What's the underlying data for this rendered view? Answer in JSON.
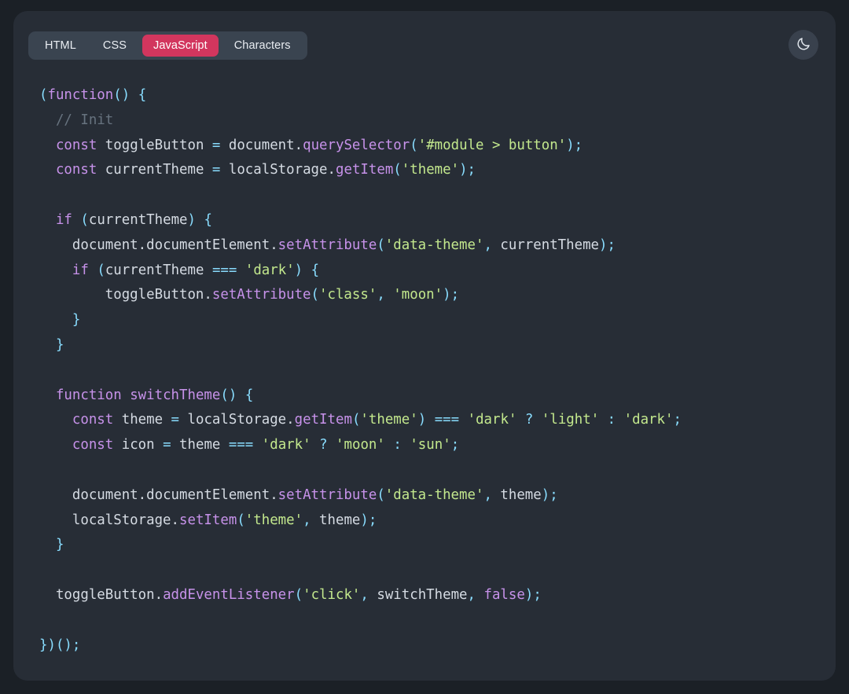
{
  "window": {
    "background_color": "#1b2026",
    "card_color": "#272d36"
  },
  "tabs": {
    "items": [
      {
        "label": "HTML",
        "active": false
      },
      {
        "label": "CSS",
        "active": false
      },
      {
        "label": "JavaScript",
        "active": true
      },
      {
        "label": "Characters",
        "active": false
      }
    ],
    "active_color": "#d2365e",
    "bar_color": "#3a4450"
  },
  "theme_toggle": {
    "icon": "moon-icon",
    "label": "Toggle dark mode",
    "background_color": "#39414d"
  },
  "editor": {
    "language": "JavaScript",
    "colors": {
      "keyword": "#c792ea",
      "function": "#c792ea",
      "punctuation": "#89ddff",
      "string": "#c3e88d",
      "identifier": "#d5dbe3",
      "comment": "#67737f"
    },
    "code_plain": "(function() {\n  // Init\n  const toggleButton = document.querySelector('#module > button');\n  const currentTheme = localStorage.getItem('theme');\n\n  if (currentTheme) {\n    document.documentElement.setAttribute('data-theme', currentTheme);\n    if (currentTheme === 'dark') {\n        toggleButton.setAttribute('class', 'moon');\n    }\n  }\n\n  function switchTheme() {\n    const theme = localStorage.getItem('theme') === 'dark' ? 'light' : 'dark';\n    const icon = theme === 'dark' ? 'moon' : 'sun';\n\n    document.documentElement.setAttribute('data-theme', theme);\n    localStorage.setItem('theme', theme);\n  }\n\n  toggleButton.addEventListener('click', switchTheme, false);\n\n})();",
    "lines": [
      [
        {
          "t": "(",
          "c": "pun"
        },
        {
          "t": "function",
          "c": "kw"
        },
        {
          "t": "()",
          "c": "pun"
        },
        {
          "t": " ",
          "c": "id"
        },
        {
          "t": "{",
          "c": "pun"
        }
      ],
      [
        {
          "t": "  ",
          "c": "id"
        },
        {
          "t": "// Init",
          "c": "com"
        }
      ],
      [
        {
          "t": "  ",
          "c": "id"
        },
        {
          "t": "const",
          "c": "kw"
        },
        {
          "t": " toggleButton ",
          "c": "id"
        },
        {
          "t": "=",
          "c": "pun"
        },
        {
          "t": " document",
          "c": "id"
        },
        {
          "t": ".",
          "c": "id"
        },
        {
          "t": "querySelector",
          "c": "fn"
        },
        {
          "t": "(",
          "c": "pun"
        },
        {
          "t": "'#module > button'",
          "c": "str"
        },
        {
          "t": ");",
          "c": "pun"
        }
      ],
      [
        {
          "t": "  ",
          "c": "id"
        },
        {
          "t": "const",
          "c": "kw"
        },
        {
          "t": " currentTheme ",
          "c": "id"
        },
        {
          "t": "=",
          "c": "pun"
        },
        {
          "t": " localStorage",
          "c": "id"
        },
        {
          "t": ".",
          "c": "id"
        },
        {
          "t": "getItem",
          "c": "fn"
        },
        {
          "t": "(",
          "c": "pun"
        },
        {
          "t": "'theme'",
          "c": "str"
        },
        {
          "t": ");",
          "c": "pun"
        }
      ],
      [
        {
          "t": "",
          "c": "id"
        }
      ],
      [
        {
          "t": "  ",
          "c": "id"
        },
        {
          "t": "if",
          "c": "kw"
        },
        {
          "t": " ",
          "c": "id"
        },
        {
          "t": "(",
          "c": "pun"
        },
        {
          "t": "currentTheme",
          "c": "id"
        },
        {
          "t": ")",
          "c": "pun"
        },
        {
          "t": " ",
          "c": "id"
        },
        {
          "t": "{",
          "c": "pun"
        }
      ],
      [
        {
          "t": "    document",
          "c": "id"
        },
        {
          "t": ".",
          "c": "id"
        },
        {
          "t": "documentElement",
          "c": "id"
        },
        {
          "t": ".",
          "c": "id"
        },
        {
          "t": "setAttribute",
          "c": "fn"
        },
        {
          "t": "(",
          "c": "pun"
        },
        {
          "t": "'data-theme'",
          "c": "str"
        },
        {
          "t": ",",
          "c": "pun"
        },
        {
          "t": " currentTheme",
          "c": "id"
        },
        {
          "t": ");",
          "c": "pun"
        }
      ],
      [
        {
          "t": "    ",
          "c": "id"
        },
        {
          "t": "if",
          "c": "kw"
        },
        {
          "t": " ",
          "c": "id"
        },
        {
          "t": "(",
          "c": "pun"
        },
        {
          "t": "currentTheme ",
          "c": "id"
        },
        {
          "t": "===",
          "c": "pun"
        },
        {
          "t": " ",
          "c": "id"
        },
        {
          "t": "'dark'",
          "c": "str"
        },
        {
          "t": ")",
          "c": "pun"
        },
        {
          "t": " ",
          "c": "id"
        },
        {
          "t": "{",
          "c": "pun"
        }
      ],
      [
        {
          "t": "        toggleButton",
          "c": "id"
        },
        {
          "t": ".",
          "c": "id"
        },
        {
          "t": "setAttribute",
          "c": "fn"
        },
        {
          "t": "(",
          "c": "pun"
        },
        {
          "t": "'class'",
          "c": "str"
        },
        {
          "t": ",",
          "c": "pun"
        },
        {
          "t": " ",
          "c": "id"
        },
        {
          "t": "'moon'",
          "c": "str"
        },
        {
          "t": ");",
          "c": "pun"
        }
      ],
      [
        {
          "t": "    ",
          "c": "id"
        },
        {
          "t": "}",
          "c": "pun"
        }
      ],
      [
        {
          "t": "  ",
          "c": "id"
        },
        {
          "t": "}",
          "c": "pun"
        }
      ],
      [
        {
          "t": "",
          "c": "id"
        }
      ],
      [
        {
          "t": "  ",
          "c": "id"
        },
        {
          "t": "function",
          "c": "kw"
        },
        {
          "t": " ",
          "c": "id"
        },
        {
          "t": "switchTheme",
          "c": "fn"
        },
        {
          "t": "()",
          "c": "pun"
        },
        {
          "t": " ",
          "c": "id"
        },
        {
          "t": "{",
          "c": "pun"
        }
      ],
      [
        {
          "t": "    ",
          "c": "id"
        },
        {
          "t": "const",
          "c": "kw"
        },
        {
          "t": " theme ",
          "c": "id"
        },
        {
          "t": "=",
          "c": "pun"
        },
        {
          "t": " localStorage",
          "c": "id"
        },
        {
          "t": ".",
          "c": "id"
        },
        {
          "t": "getItem",
          "c": "fn"
        },
        {
          "t": "(",
          "c": "pun"
        },
        {
          "t": "'theme'",
          "c": "str"
        },
        {
          "t": ")",
          "c": "pun"
        },
        {
          "t": " ",
          "c": "id"
        },
        {
          "t": "===",
          "c": "pun"
        },
        {
          "t": " ",
          "c": "id"
        },
        {
          "t": "'dark'",
          "c": "str"
        },
        {
          "t": " ",
          "c": "id"
        },
        {
          "t": "?",
          "c": "pun"
        },
        {
          "t": " ",
          "c": "id"
        },
        {
          "t": "'light'",
          "c": "str"
        },
        {
          "t": " ",
          "c": "id"
        },
        {
          "t": ":",
          "c": "pun"
        },
        {
          "t": " ",
          "c": "id"
        },
        {
          "t": "'dark'",
          "c": "str"
        },
        {
          "t": ";",
          "c": "pun"
        }
      ],
      [
        {
          "t": "    ",
          "c": "id"
        },
        {
          "t": "const",
          "c": "kw"
        },
        {
          "t": " icon ",
          "c": "id"
        },
        {
          "t": "=",
          "c": "pun"
        },
        {
          "t": " theme ",
          "c": "id"
        },
        {
          "t": "===",
          "c": "pun"
        },
        {
          "t": " ",
          "c": "id"
        },
        {
          "t": "'dark'",
          "c": "str"
        },
        {
          "t": " ",
          "c": "id"
        },
        {
          "t": "?",
          "c": "pun"
        },
        {
          "t": " ",
          "c": "id"
        },
        {
          "t": "'moon'",
          "c": "str"
        },
        {
          "t": " ",
          "c": "id"
        },
        {
          "t": ":",
          "c": "pun"
        },
        {
          "t": " ",
          "c": "id"
        },
        {
          "t": "'sun'",
          "c": "str"
        },
        {
          "t": ";",
          "c": "pun"
        }
      ],
      [
        {
          "t": "",
          "c": "id"
        }
      ],
      [
        {
          "t": "    document",
          "c": "id"
        },
        {
          "t": ".",
          "c": "id"
        },
        {
          "t": "documentElement",
          "c": "id"
        },
        {
          "t": ".",
          "c": "id"
        },
        {
          "t": "setAttribute",
          "c": "fn"
        },
        {
          "t": "(",
          "c": "pun"
        },
        {
          "t": "'data-theme'",
          "c": "str"
        },
        {
          "t": ",",
          "c": "pun"
        },
        {
          "t": " theme",
          "c": "id"
        },
        {
          "t": ");",
          "c": "pun"
        }
      ],
      [
        {
          "t": "    localStorage",
          "c": "id"
        },
        {
          "t": ".",
          "c": "id"
        },
        {
          "t": "setItem",
          "c": "fn"
        },
        {
          "t": "(",
          "c": "pun"
        },
        {
          "t": "'theme'",
          "c": "str"
        },
        {
          "t": ",",
          "c": "pun"
        },
        {
          "t": " theme",
          "c": "id"
        },
        {
          "t": ");",
          "c": "pun"
        }
      ],
      [
        {
          "t": "  ",
          "c": "id"
        },
        {
          "t": "}",
          "c": "pun"
        }
      ],
      [
        {
          "t": "",
          "c": "id"
        }
      ],
      [
        {
          "t": "  toggleButton",
          "c": "id"
        },
        {
          "t": ".",
          "c": "id"
        },
        {
          "t": "addEventListener",
          "c": "fn"
        },
        {
          "t": "(",
          "c": "pun"
        },
        {
          "t": "'click'",
          "c": "str"
        },
        {
          "t": ",",
          "c": "pun"
        },
        {
          "t": " switchTheme",
          "c": "id"
        },
        {
          "t": ",",
          "c": "pun"
        },
        {
          "t": " ",
          "c": "id"
        },
        {
          "t": "false",
          "c": "kw"
        },
        {
          "t": ");",
          "c": "pun"
        }
      ],
      [
        {
          "t": "",
          "c": "id"
        }
      ],
      [
        {
          "t": "}",
          "c": "pun"
        },
        {
          "t": ")();",
          "c": "pun"
        }
      ]
    ]
  }
}
